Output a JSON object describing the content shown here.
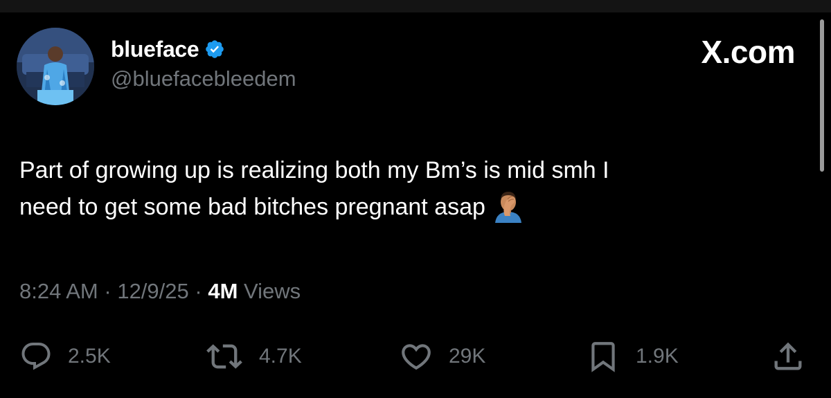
{
  "author": {
    "display_name": "blueface",
    "handle": "@bluefacebleedem",
    "verified": true,
    "verified_color": "#1d9bf0",
    "avatar_icon": "user-avatar"
  },
  "site_logo": "X.com",
  "tweet": {
    "text_lines": [
      "Part of growing up is realizing both my Bm’s is mid smh I",
      "need to get some bad bitches pregnant asap"
    ],
    "trailing_emoji": "man-facepalming-emoji"
  },
  "meta": {
    "time": "8:24 AM",
    "separator": "·",
    "date": "12/9/25",
    "views_count": "4M",
    "views_label": "Views"
  },
  "actions": {
    "replies": "2.5K",
    "reposts": "4.7K",
    "likes": "29K",
    "bookmarks": "1.9K"
  },
  "colors": {
    "background": "#000000",
    "text_primary": "#ffffff",
    "text_secondary": "#71767b",
    "accent": "#1d9bf0"
  }
}
